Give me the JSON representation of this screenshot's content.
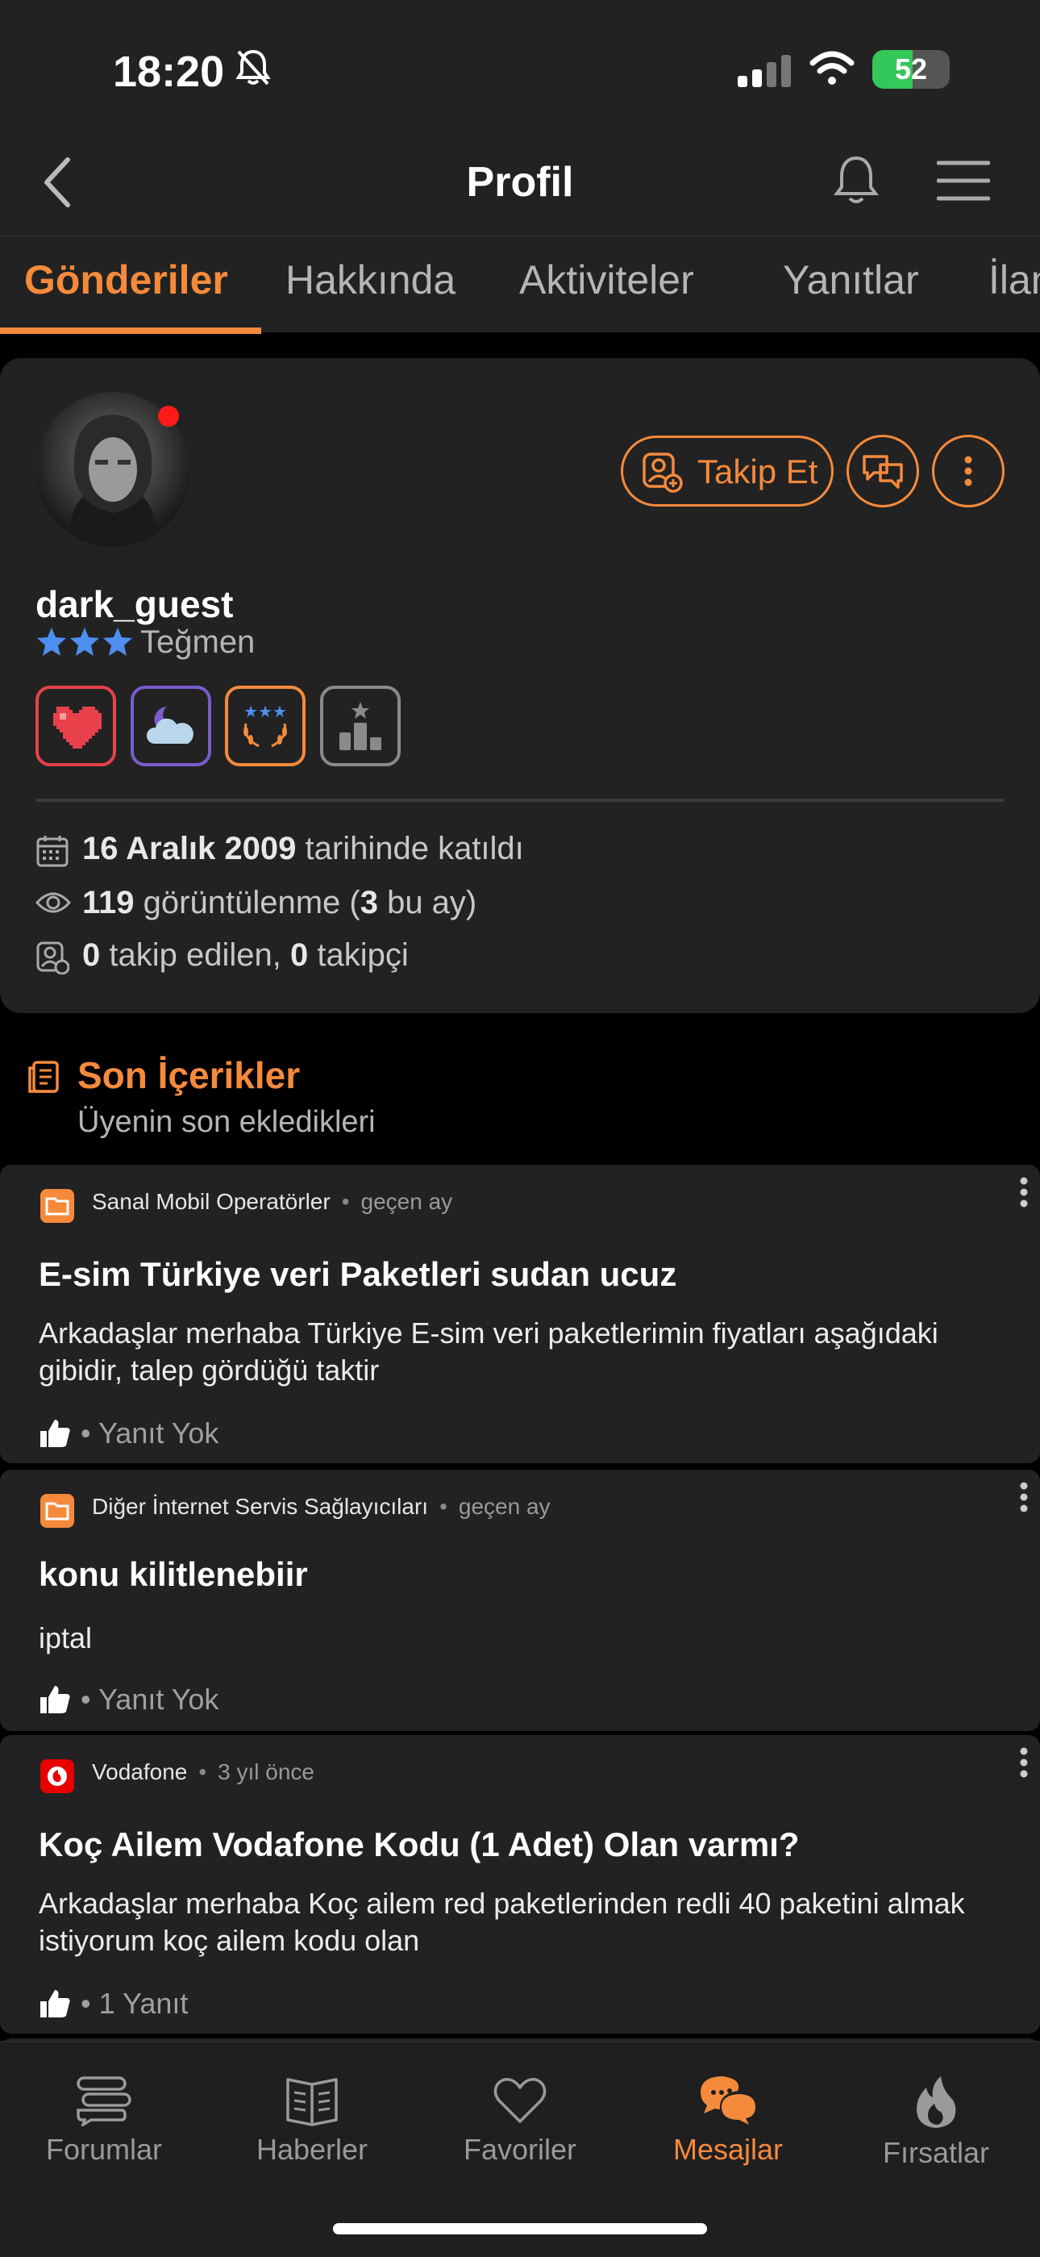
{
  "status": {
    "time": "18:20",
    "battery": "52",
    "battery_fraction": 0.52,
    "mute_icon": "bell-slash-icon"
  },
  "nav": {
    "title": "Profil"
  },
  "tabs": [
    {
      "label": "Gönderiler",
      "active": true
    },
    {
      "label": "Hakkında"
    },
    {
      "label": "Aktiviteler"
    },
    {
      "label": "Yanıtlar"
    },
    {
      "label": "İlan"
    }
  ],
  "profile": {
    "username": "dark_guest",
    "rank": "Teğmen",
    "follow_label": "Takip Et",
    "join": {
      "date": "16 Aralık 2009",
      "suffix": "tarihinde katıldı"
    },
    "views": {
      "count": "119",
      "text1": "görüntülenme (",
      "month": "3",
      "text2": "bu ay)"
    },
    "follow": {
      "following": "0",
      "following_label": "takip edilen,",
      "followers": "0",
      "followers_label": "takipçi"
    },
    "badges": [
      "heart-badge",
      "moon-cloud-badge",
      "stars-laurel-badge",
      "ranking-badge"
    ]
  },
  "section": {
    "title": "Son İçerikler",
    "subtitle": "Üyenin son ekledikleri"
  },
  "posts": [
    {
      "category": "Sanal Mobil Operatörler",
      "time": "geçen ay",
      "title": "E-sim Türkiye veri Paketleri sudan ucuz",
      "body": "Arkadaşlar merhaba Türkiye E-sim veri paketlerimin fiyatları aşağıdaki gibidir, talep gördüğü taktir",
      "replies": "• Yanıt Yok"
    },
    {
      "category": "Diğer İnternet Servis Sağlayıcıları",
      "time": "geçen ay",
      "title": "konu kilitlenebiir",
      "body": "iptal",
      "replies": "• Yanıt Yok"
    },
    {
      "category": "Vodafone",
      "time": "3 yıl önce",
      "title": "Koç Ailem Vodafone Kodu (1 Adet) Olan varmı?",
      "body": "Arkadaşlar merhaba Koç ailem red paketlerinden redli 40 paketini almak istiyorum koç ailem kodu olan",
      "replies": "• 1 Yanıt"
    }
  ],
  "bottom_tabs": [
    {
      "label": "Forumlar",
      "icon": "forums-icon"
    },
    {
      "label": "Haberler",
      "icon": "news-icon"
    },
    {
      "label": "Favoriler",
      "icon": "heart-icon"
    },
    {
      "label": "Mesajlar",
      "icon": "messages-icon",
      "active": true
    },
    {
      "label": "Fırsatlar",
      "icon": "flame-icon"
    }
  ],
  "colors": {
    "accent": "#f58a3c",
    "background": "#000000",
    "card": "#222222",
    "online": "#ff1a1a",
    "vodafone": "#e60000"
  }
}
